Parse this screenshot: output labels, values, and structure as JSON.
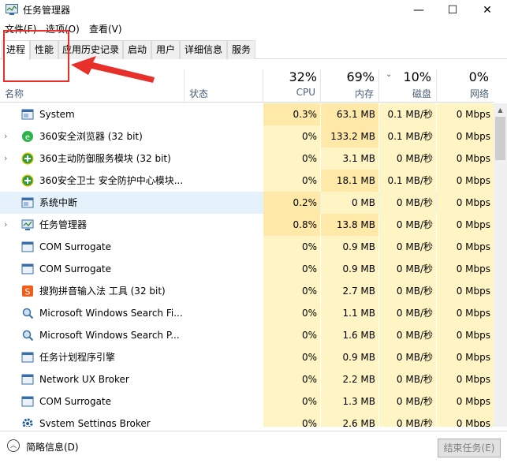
{
  "window": {
    "title": "任务管理器",
    "min_glyph": "—",
    "max_glyph": "☐",
    "close_glyph": "✕"
  },
  "menu": {
    "file": "文件(F)",
    "options": "选项(O)",
    "view": "查看(V)"
  },
  "tabs": [
    "进程",
    "性能",
    "应用历史记录",
    "启动",
    "用户",
    "详细信息",
    "服务"
  ],
  "active_tab": "进程",
  "columns": {
    "name": "名称",
    "status": "状态",
    "cpu": {
      "pct": "32%",
      "label": "CPU"
    },
    "memory": {
      "pct": "69%",
      "label": "内存"
    },
    "disk": {
      "pct": "10%",
      "label": "磁盘"
    },
    "network": {
      "pct": "0%",
      "label": "网络"
    }
  },
  "processes": [
    {
      "name": "System",
      "cpu": "0.3%",
      "memory": "63.1 MB",
      "disk": "0.1 MB/秒",
      "network": "0 Mbps",
      "expandable": false,
      "icon": "system-window-icon"
    },
    {
      "name": "360安全浏览器 (32 bit)",
      "cpu": "0%",
      "memory": "133.2 MB",
      "disk": "0.1 MB/秒",
      "network": "0 Mbps",
      "expandable": true,
      "icon": "360-browser-icon"
    },
    {
      "name": "360主动防御服务模块 (32 bit)",
      "cpu": "0%",
      "memory": "3.1 MB",
      "disk": "0 MB/秒",
      "network": "0 Mbps",
      "expandable": true,
      "icon": "360-defense-icon"
    },
    {
      "name": "360安全卫士 安全防护中心模块...",
      "cpu": "0%",
      "memory": "18.1 MB",
      "disk": "0.1 MB/秒",
      "network": "0 Mbps",
      "expandable": false,
      "icon": "360-guard-icon"
    },
    {
      "name": "系统中断",
      "cpu": "0.2%",
      "memory": "0 MB",
      "disk": "0 MB/秒",
      "network": "0 Mbps",
      "expandable": false,
      "icon": "system-window-icon",
      "selected": true
    },
    {
      "name": "任务管理器",
      "cpu": "0.8%",
      "memory": "13.8 MB",
      "disk": "0 MB/秒",
      "network": "0 Mbps",
      "expandable": true,
      "icon": "task-manager-icon"
    },
    {
      "name": "COM Surrogate",
      "cpu": "0%",
      "memory": "0.9 MB",
      "disk": "0 MB/秒",
      "network": "0 Mbps",
      "expandable": false,
      "icon": "generic-window-icon"
    },
    {
      "name": "COM Surrogate",
      "cpu": "0%",
      "memory": "0.9 MB",
      "disk": "0 MB/秒",
      "network": "0 Mbps",
      "expandable": false,
      "icon": "generic-window-icon"
    },
    {
      "name": "搜狗拼音输入法 工具 (32 bit)",
      "cpu": "0%",
      "memory": "2.7 MB",
      "disk": "0 MB/秒",
      "network": "0 Mbps",
      "expandable": false,
      "icon": "sogou-icon"
    },
    {
      "name": "Microsoft Windows Search Fi...",
      "cpu": "0%",
      "memory": "1.1 MB",
      "disk": "0 MB/秒",
      "network": "0 Mbps",
      "expandable": false,
      "icon": "search-service-icon"
    },
    {
      "name": "Microsoft Windows Search P...",
      "cpu": "0%",
      "memory": "1.6 MB",
      "disk": "0 MB/秒",
      "network": "0 Mbps",
      "expandable": false,
      "icon": "search-service-icon"
    },
    {
      "name": "任务计划程序引擎",
      "cpu": "0%",
      "memory": "0.9 MB",
      "disk": "0 MB/秒",
      "network": "0 Mbps",
      "expandable": false,
      "icon": "generic-window-icon"
    },
    {
      "name": "Network UX Broker",
      "cpu": "0%",
      "memory": "2.2 MB",
      "disk": "0 MB/秒",
      "network": "0 Mbps",
      "expandable": false,
      "icon": "generic-window-icon"
    },
    {
      "name": "COM Surrogate",
      "cpu": "0%",
      "memory": "1.3 MB",
      "disk": "0 MB/秒",
      "network": "0 Mbps",
      "expandable": false,
      "icon": "generic-window-icon"
    },
    {
      "name": "System Settings Broker",
      "cpu": "0%",
      "memory": "2.6 MB",
      "disk": "0 MB/秒",
      "network": "0 Mbps",
      "expandable": false,
      "icon": "settings-gear-icon"
    }
  ],
  "footer": {
    "toggle_label": "简略信息(D)",
    "end_task_label": "结束任务(E)"
  },
  "colors": {
    "annotation_red": "#e8302a",
    "heat_light": "#fff4c4",
    "heat_strong": "#ffe9a8",
    "selected_row": "#e5f1fb"
  }
}
